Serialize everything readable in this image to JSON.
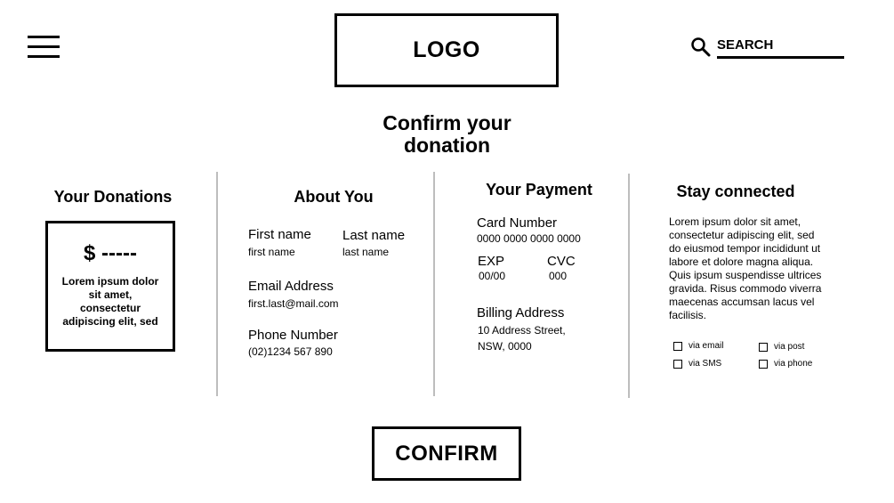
{
  "header": {
    "logo": "LOGO",
    "search": {
      "placeholder": "SEARCH"
    }
  },
  "page_title": {
    "line1": "Confirm your",
    "line2": "donation"
  },
  "donations": {
    "title": "Your Donations",
    "amount": "$ -----",
    "description": "Lorem ipsum dolor sit amet, consectetur adipiscing elit, sed"
  },
  "about": {
    "title": "About You",
    "first_name_label": "First name",
    "first_name_value": "first name",
    "last_name_label": "Last name",
    "last_name_value": "last name",
    "email_label": "Email Address",
    "email_value": "first.last@mail.com",
    "phone_label": "Phone Number",
    "phone_value": "(02)1234 567 890"
  },
  "payment": {
    "title": "Your Payment",
    "card_label": "Card Number",
    "card_value": "0000 0000 0000 0000",
    "exp_label": "EXP",
    "exp_value": "00/00",
    "cvc_label": "CVC",
    "cvc_value": "000",
    "billing_label": "Billing Address",
    "billing_line1": "10 Address Street,",
    "billing_line2": "NSW, 0000"
  },
  "connect": {
    "title": "Stay connected",
    "text": "Lorem ipsum dolor sit amet, consectetur adipiscing elit, sed do eiusmod tempor incididunt ut labore et dolore magna aliqua. Quis ipsum suspendisse ultrices gravida. Risus commodo viverra maecenas accumsan lacus vel facilisis.",
    "options": [
      "via email",
      "via post",
      "via SMS",
      "via phone"
    ]
  },
  "confirm_label": "CONFIRM"
}
